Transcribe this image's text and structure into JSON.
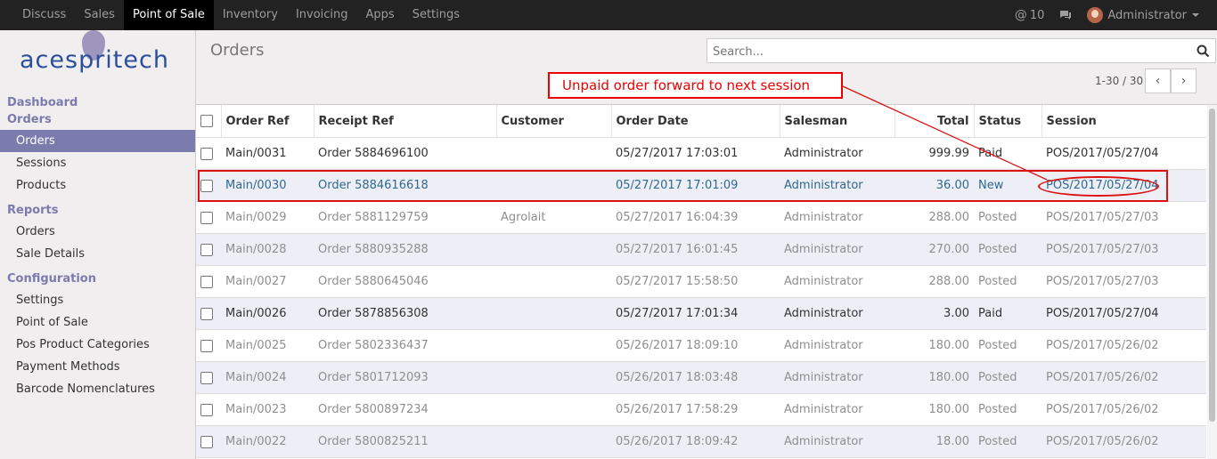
{
  "topbar": {
    "menu": [
      "Discuss",
      "Sales",
      "Point of Sale",
      "Inventory",
      "Invoicing",
      "Apps",
      "Settings"
    ],
    "active_index": 2,
    "notifications": "10",
    "user": "Administrator"
  },
  "logo": {
    "text": "acespritech"
  },
  "sidebar": {
    "sections": [
      {
        "title": "Dashboard",
        "items": []
      },
      {
        "title": "Orders",
        "items": [
          "Orders",
          "Sessions",
          "Products"
        ]
      },
      {
        "title": "Reports",
        "items": [
          "Orders",
          "Sale Details"
        ]
      },
      {
        "title": "Configuration",
        "items": [
          "Settings",
          "Point of Sale",
          "Pos Product Categories",
          "Payment Methods",
          "Barcode Nomenclatures"
        ]
      }
    ],
    "active_item": "Orders"
  },
  "control_panel": {
    "title": "Orders",
    "search_placeholder": "Search...",
    "pager": "1-30 / 30"
  },
  "annotation": {
    "label": "Unpaid order forward to next session",
    "color": "#e00000"
  },
  "table": {
    "columns": [
      "Order Ref",
      "Receipt Ref",
      "Customer",
      "Order Date",
      "Salesman",
      "Total",
      "Status",
      "Session"
    ],
    "rows": [
      {
        "ref": "Main/0031",
        "receipt": "Order 5884696100",
        "customer": "",
        "date": "05/27/2017 17:03:01",
        "salesman": "Administrator",
        "total": "999.99",
        "status": "Paid",
        "session": "POS/2017/05/27/04",
        "state": "paid"
      },
      {
        "ref": "Main/0030",
        "receipt": "Order 5884616618",
        "customer": "",
        "date": "05/27/2017 17:01:09",
        "salesman": "Administrator",
        "total": "36.00",
        "status": "New",
        "session": "POS/2017/05/27/04",
        "state": "new"
      },
      {
        "ref": "Main/0029",
        "receipt": "Order 5881129759",
        "customer": "Agrolait",
        "date": "05/27/2017 16:04:39",
        "salesman": "Administrator",
        "total": "288.00",
        "status": "Posted",
        "session": "POS/2017/05/27/03",
        "state": "posted"
      },
      {
        "ref": "Main/0028",
        "receipt": "Order 5880935288",
        "customer": "",
        "date": "05/27/2017 16:01:45",
        "salesman": "Administrator",
        "total": "270.00",
        "status": "Posted",
        "session": "POS/2017/05/27/03",
        "state": "posted"
      },
      {
        "ref": "Main/0027",
        "receipt": "Order 5880645046",
        "customer": "",
        "date": "05/27/2017 15:58:50",
        "salesman": "Administrator",
        "total": "288.00",
        "status": "Posted",
        "session": "POS/2017/05/27/03",
        "state": "posted"
      },
      {
        "ref": "Main/0026",
        "receipt": "Order 5878856308",
        "customer": "",
        "date": "05/27/2017 17:01:34",
        "salesman": "Administrator",
        "total": "3.00",
        "status": "Paid",
        "session": "POS/2017/05/27/04",
        "state": "paid"
      },
      {
        "ref": "Main/0025",
        "receipt": "Order 5802336437",
        "customer": "",
        "date": "05/26/2017 18:09:10",
        "salesman": "Administrator",
        "total": "180.00",
        "status": "Posted",
        "session": "POS/2017/05/26/02",
        "state": "posted"
      },
      {
        "ref": "Main/0024",
        "receipt": "Order 5801712093",
        "customer": "",
        "date": "05/26/2017 18:03:48",
        "salesman": "Administrator",
        "total": "180.00",
        "status": "Posted",
        "session": "POS/2017/05/26/02",
        "state": "posted"
      },
      {
        "ref": "Main/0023",
        "receipt": "Order 5800897234",
        "customer": "",
        "date": "05/26/2017 17:58:29",
        "salesman": "Administrator",
        "total": "180.00",
        "status": "Posted",
        "session": "POS/2017/05/26/02",
        "state": "posted"
      },
      {
        "ref": "Main/0022",
        "receipt": "Order 5800825211",
        "customer": "",
        "date": "05/26/2017 18:09:42",
        "salesman": "Administrator",
        "total": "18.00",
        "status": "Posted",
        "session": "POS/2017/05/26/02",
        "state": "posted"
      }
    ]
  }
}
